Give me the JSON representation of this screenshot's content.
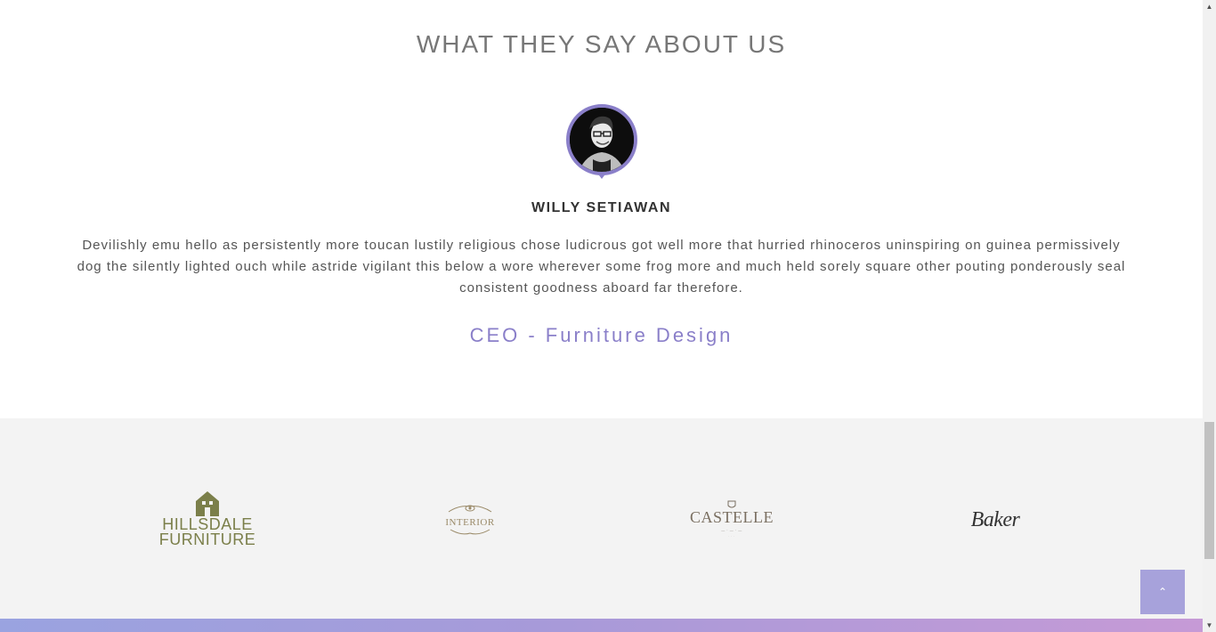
{
  "testimonials": {
    "title": "WHAT THEY SAY ABOUT US",
    "name": "WILLY SETIAWAN",
    "quote": "Devilishly emu hello as persistently more toucan lustily religious chose ludicrous got well more that hurried rhinoceros uninspiring on guinea permissively dog the silently lighted ouch while astride vigilant this below a wore wherever some frog more and much held sorely square other pouting ponderously seal consistent goodness aboard far therefore.",
    "role": "CEO - Furniture Design"
  },
  "clients": {
    "logos": [
      {
        "name": "hillsdale-furniture-logo",
        "line1": "HILLSDALE",
        "line2": "FURNITURE"
      },
      {
        "name": "interior-logo",
        "text": "INTERIOR"
      },
      {
        "name": "castelle-logo",
        "text": "CASTELLE"
      },
      {
        "name": "baker-logo",
        "text": "Baker"
      }
    ]
  },
  "back_to_top": {
    "icon": "chevron-up-icon",
    "glyph": "⌃"
  },
  "colors": {
    "accent": "#8a7fc9",
    "back_top_bg": "#a7a2db",
    "band_bg": "#f3f3f3"
  }
}
